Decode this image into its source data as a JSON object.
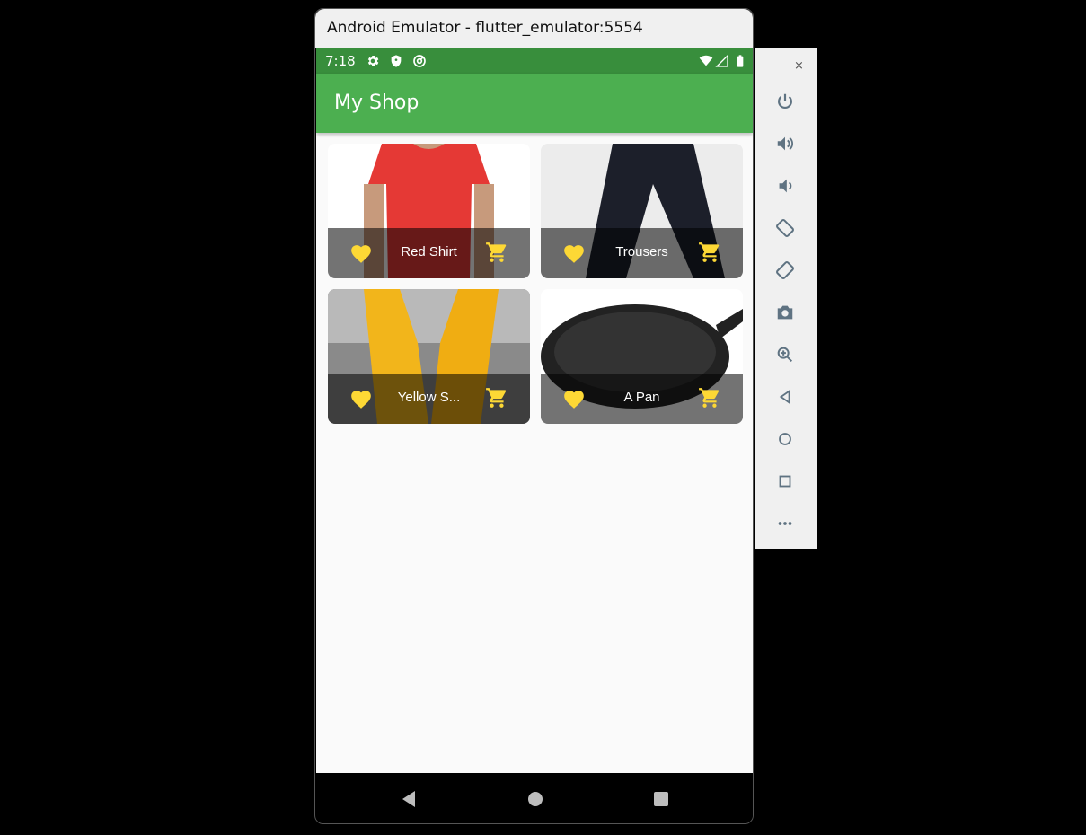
{
  "window": {
    "title": "Android Emulator - flutter_emulator:5554"
  },
  "status_bar": {
    "time": "7:18"
  },
  "app_bar": {
    "title": "My Shop"
  },
  "products": [
    {
      "title": "Red Shirt"
    },
    {
      "title": "Trousers"
    },
    {
      "title": "Yellow Scarf",
      "display": "Yellow S..."
    },
    {
      "title": "A Pan"
    }
  ],
  "toolbar": {
    "minimize_label": "–",
    "close_label": "×",
    "items": [
      "power-icon",
      "volume-up-icon",
      "volume-down-icon",
      "rotate-left-icon",
      "rotate-right-icon",
      "camera-icon",
      "zoom-icon",
      "back-icon",
      "home-icon",
      "overview-icon",
      "more-icon"
    ]
  },
  "colors": {
    "app_bar": "#4caf50",
    "status_bar": "#388e3c",
    "accent": "#fdd835"
  }
}
